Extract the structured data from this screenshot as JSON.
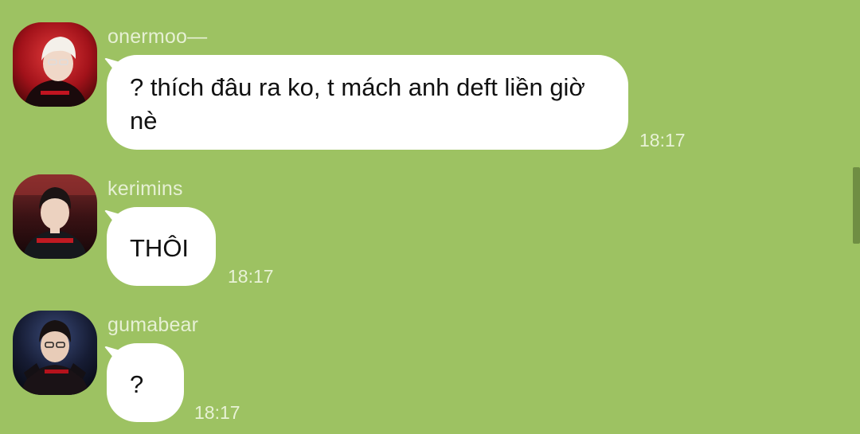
{
  "messages": [
    {
      "sender": "onermoo—",
      "text": "? thích đâu ra ko, t mách anh deft liền giờ nè",
      "time": "18:17"
    },
    {
      "sender": "kerimins",
      "text": "THÔI",
      "time": "18:17"
    },
    {
      "sender": "gumabear",
      "text": "?",
      "time": "18:17"
    }
  ],
  "colors": {
    "background": "#9dc262",
    "bubble": "#ffffff",
    "meta_text": "#e6f0d4"
  }
}
